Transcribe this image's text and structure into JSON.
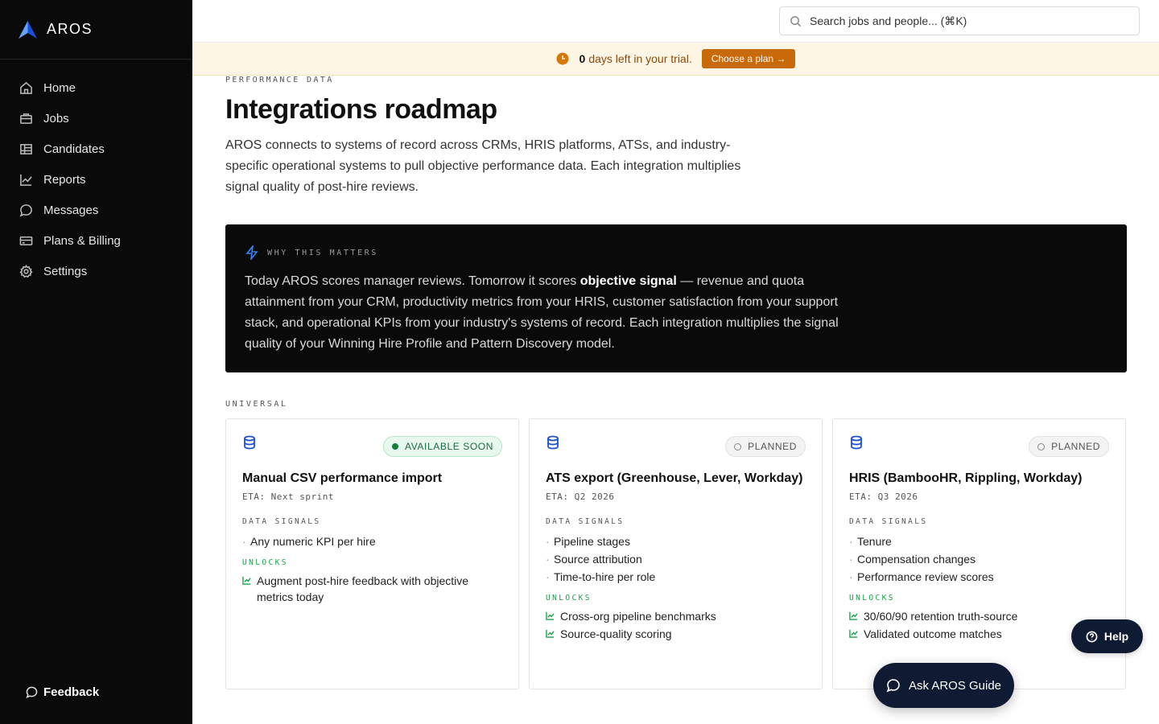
{
  "app": {
    "name": "AROS"
  },
  "sidebar": {
    "items": [
      {
        "label": "Home",
        "icon": "home-icon"
      },
      {
        "label": "Jobs",
        "icon": "briefcase-icon"
      },
      {
        "label": "Candidates",
        "icon": "candidates-icon"
      },
      {
        "label": "Reports",
        "icon": "chart-icon"
      },
      {
        "label": "Messages",
        "icon": "message-icon"
      },
      {
        "label": "Plans & Billing",
        "icon": "card-icon"
      },
      {
        "label": "Settings",
        "icon": "gear-icon"
      }
    ],
    "feedback_label": "Feedback"
  },
  "search": {
    "placeholder": "Search jobs and people...  (⌘K)"
  },
  "trial": {
    "days": "0",
    "text": "days left in your trial.",
    "cta": "Choose a plan →"
  },
  "page": {
    "eyebrow": "PERFORMANCE DATA",
    "title": "Integrations roadmap",
    "lead": "AROS connects to systems of record across CRMs, HRIS platforms, ATSs, and industry-specific operational systems to pull objective performance data. Each integration multiplies signal quality of post-hire reviews."
  },
  "callout": {
    "label": "WHY THIS MATTERS",
    "text_before": "Today AROS scores manager reviews. Tomorrow it scores ",
    "emphasis": "objective signal",
    "text_after": " — revenue and quota attainment from your CRM, productivity metrics from your HRIS, customer satisfaction from your support stack, and operational KPIs from your industry's systems of record. Each integration multiplies the signal quality of your Winning Hire Profile and Pattern Discovery model."
  },
  "section": {
    "label": "UNIVERSAL"
  },
  "labels": {
    "data_signals": "DATA SIGNALS",
    "unlocks": "UNLOCKS"
  },
  "cards": [
    {
      "title": "Manual CSV performance import",
      "status": "AVAILABLE SOON",
      "eta": "ETA: Next sprint",
      "signals": [
        "Any numeric KPI per hire"
      ],
      "unlocks": [
        "Augment post-hire feedback with objective metrics today"
      ]
    },
    {
      "title": "ATS export (Greenhouse, Lever, Workday)",
      "status": "PLANNED",
      "eta": "ETA: Q2 2026",
      "signals": [
        "Pipeline stages",
        "Source attribution",
        "Time-to-hire per role"
      ],
      "unlocks": [
        "Cross-org pipeline benchmarks",
        "Source-quality scoring"
      ]
    },
    {
      "title": "HRIS (BambooHR, Rippling, Workday)",
      "status": "PLANNED",
      "eta": "ETA: Q3 2026",
      "signals": [
        "Tenure",
        "Compensation changes",
        "Performance review scores"
      ],
      "unlocks": [
        "30/60/90 retention truth-source",
        "Validated outcome matches"
      ]
    }
  ],
  "floating": {
    "help": "Help",
    "guide": "Ask AROS Guide"
  }
}
